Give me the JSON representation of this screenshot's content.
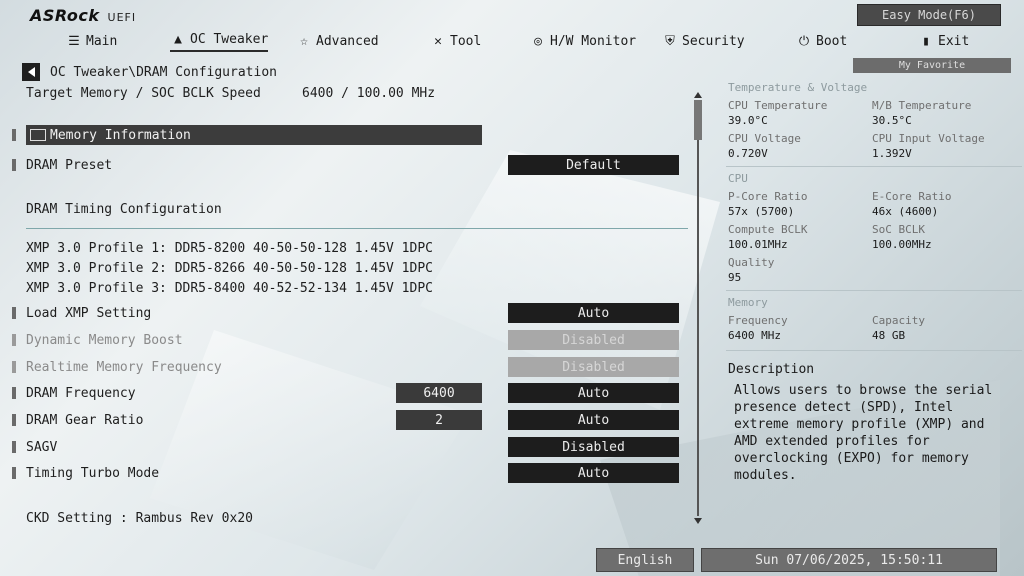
{
  "header": {
    "brand": "ASRock",
    "uefi": "UEFI",
    "easy_mode": "Easy Mode(F6)",
    "my_favorite": "My Favorite"
  },
  "nav": [
    {
      "label": "Main",
      "icon": "list-icon"
    },
    {
      "label": "OC Tweaker",
      "icon": "rocket-icon"
    },
    {
      "label": "Advanced",
      "icon": "star-icon"
    },
    {
      "label": "Tool",
      "icon": "tools-icon"
    },
    {
      "label": "H/W Monitor",
      "icon": "monitor-gauge-icon"
    },
    {
      "label": "Security",
      "icon": "shield-icon"
    },
    {
      "label": "Boot",
      "icon": "power-icon"
    },
    {
      "label": "Exit",
      "icon": "exit-door-icon"
    }
  ],
  "breadcrumb": "OC Tweaker\\DRAM Configuration",
  "target": {
    "label": "Target Memory / SOC BCLK Speed",
    "value": "6400 / 100.00 MHz"
  },
  "settings": {
    "memory_information": "Memory Information",
    "dram_preset": {
      "label": "DRAM Preset",
      "value": "Default"
    },
    "timing_config": "DRAM Timing Configuration",
    "xmp": [
      "XMP 3.0 Profile 1: DDR5-8200 40-50-50-128 1.45V 1DPC",
      "XMP 3.0 Profile 2: DDR5-8266 40-50-50-128 1.45V 1DPC",
      "XMP 3.0 Profile 3: DDR5-8400 40-52-52-134 1.45V 1DPC"
    ],
    "load_xmp": {
      "label": "Load XMP Setting",
      "value": "Auto"
    },
    "dynamic_boost": {
      "label": "Dynamic Memory Boost",
      "value": "Disabled"
    },
    "realtime_freq": {
      "label": "Realtime Memory Frequency",
      "value": "Disabled"
    },
    "dram_freq": {
      "label": "DRAM Frequency",
      "num": "6400",
      "value": "Auto"
    },
    "gear_ratio": {
      "label": "DRAM Gear Ratio",
      "num": "2",
      "value": "Auto"
    },
    "sagv": {
      "label": "SAGV",
      "value": "Disabled"
    },
    "timing_turbo": {
      "label": "Timing Turbo Mode",
      "value": "Auto"
    },
    "ckd": "CKD Setting : Rambus Rev 0x20"
  },
  "monitor": {
    "tv_title": "Temperature & Voltage",
    "cpu_temp_label": "CPU Temperature",
    "cpu_temp": "39.0°C",
    "mb_temp_label": "M/B Temperature",
    "mb_temp": "30.5°C",
    "cpu_volt_label": "CPU Voltage",
    "cpu_volt": "0.720V",
    "cpu_in_volt_label": "CPU Input Voltage",
    "cpu_in_volt": "1.392V",
    "cpu_title": "CPU",
    "pcore_label": "P-Core Ratio",
    "pcore": "57x (5700)",
    "ecore_label": "E-Core Ratio",
    "ecore": "46x (4600)",
    "cbclk_label": "Compute BCLK",
    "cbclk": "100.01MHz",
    "socbclk_label": "SoC BCLK",
    "socbclk": "100.00MHz",
    "quality_label": "Quality",
    "quality": "95",
    "mem_title": "Memory",
    "freq_label": "Frequency",
    "freq": "6400 MHz",
    "cap_label": "Capacity",
    "cap": "48 GB"
  },
  "description": {
    "title": "Description",
    "body": "Allows users to browse the serial presence detect (SPD), Intel extreme memory profile (XMP) and AMD extended profiles for overclocking (EXPO) for memory modules."
  },
  "footer": {
    "language": "English",
    "datetime": "Sun 07/06/2025, 15:50:11"
  }
}
